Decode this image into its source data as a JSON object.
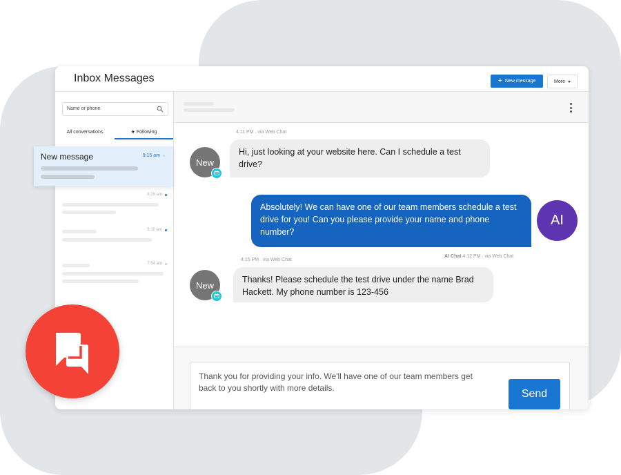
{
  "window": {
    "title": "Inbox Messages",
    "new_message_button": "New message",
    "more_button": "More"
  },
  "sidebar": {
    "search_placeholder": "Name or phone",
    "tabs": [
      {
        "label": "All conversations",
        "active": false
      },
      {
        "label": "★ Following",
        "active": true
      }
    ],
    "selected_conversation": {
      "name": "New message",
      "time": "9:15 am"
    },
    "conversations": [
      {
        "time": "8:28 am",
        "unread": true
      },
      {
        "time": "8:10 am",
        "unread": true
      },
      {
        "time": "7:54 am",
        "unread": false
      }
    ]
  },
  "chat": {
    "messages": [
      {
        "direction": "incoming",
        "avatar": "New",
        "meta": "4:11 PM . via Web Chat",
        "text": "Hi, just looking at your website here. Can I schedule a test drive?"
      },
      {
        "direction": "outgoing",
        "avatar": "AI",
        "sender": "AI Chat",
        "meta": "4:12 PM . via Web Chat",
        "text": "Absolutely! We can have one of our team members schedule a test drive for you! Can you please provide your name and phone number?"
      },
      {
        "direction": "incoming",
        "avatar": "New",
        "meta": "4:15 PM . via Web Chat",
        "text": "Thanks! Please schedule the test drive under the name Brad Hackett. My phone number is 123-456"
      }
    ],
    "composer": {
      "value": "Thank you for providing your info. We'll have one of our team members get back to you shortly with more details.",
      "send_label": "Send"
    }
  },
  "colors": {
    "primary": "#1976d2",
    "outgoing_bubble": "#1565c0",
    "ai_avatar": "#5e35b1",
    "new_avatar": "#757575",
    "badge": "#26c6da",
    "fab": "#f44336",
    "selected_row": "#e3f0fb",
    "background_blob": "#e3e6e9"
  }
}
